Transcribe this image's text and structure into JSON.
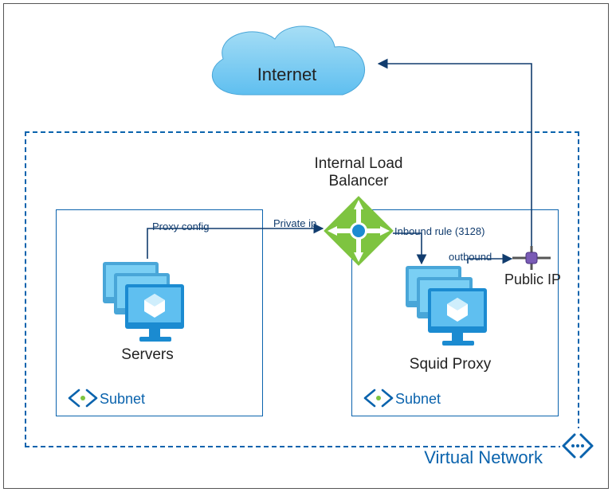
{
  "internet": {
    "label": "Internet"
  },
  "load_balancer": {
    "title": "Internal Load\nBalancer"
  },
  "servers": {
    "caption": "Servers"
  },
  "proxy": {
    "caption": "Squid Proxy"
  },
  "subnet": {
    "label_left": "Subnet",
    "label_right": "Subnet"
  },
  "vnet": {
    "label": "Virtual Network"
  },
  "public_ip": {
    "label": "Public IP"
  },
  "edges": {
    "proxy_config": "Proxy config",
    "private_ip": "Private ip",
    "inbound_rule": "Inbound rule (3128)",
    "outbound": "outbound"
  },
  "colors": {
    "azure_blue": "#0a63ad",
    "light_blue": "#7acff4",
    "dark_blue": "#113c6e",
    "green": "#7ec440"
  }
}
